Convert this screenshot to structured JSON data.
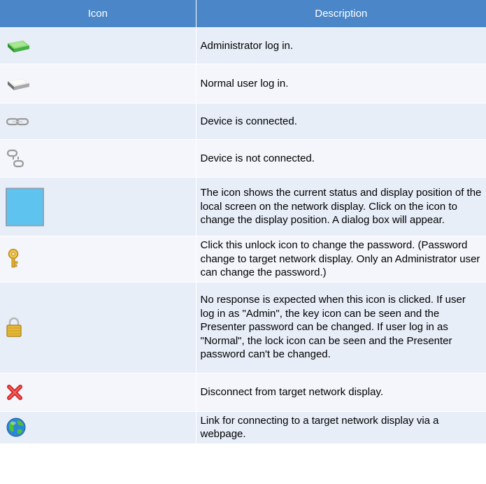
{
  "table": {
    "headers": {
      "icon": "Icon",
      "description": "Description"
    },
    "rows": [
      {
        "icon": "admin-login-drive-green-icon",
        "description": "Administrator log in."
      },
      {
        "icon": "normal-user-login-drive-gray-icon",
        "description": "Normal user log in."
      },
      {
        "icon": "chain-link-connected-icon",
        "description": "Device is connected."
      },
      {
        "icon": "broken-chain-link-icon",
        "description": "Device is not connected."
      },
      {
        "icon": "display-position-square-icon",
        "description": "The icon shows the current status and display position of the local screen on the network display. Click on the icon to change the display position. A dialog box will appear."
      },
      {
        "icon": "key-icon",
        "description": "Click this unlock icon to change the password. (Password change to target network display. Only an Administrator user can change the password.)"
      },
      {
        "icon": "padlock-icon",
        "description": "No response is expected when this icon is clicked. If user log in as \"Admin\", the key icon can be seen and the Presenter password  can be changed. If user log in as \"Normal\", the lock icon can be seen and the Presenter password can't be changed."
      },
      {
        "icon": "red-x-disconnect-icon",
        "description": "Disconnect from target network display."
      },
      {
        "icon": "globe-icon",
        "description": "Link for connecting to a target network display via a webpage."
      }
    ]
  },
  "colors": {
    "header_bg": "#4a86c8",
    "header_text": "#ffffff",
    "row_odd_bg": "#e7eef8",
    "row_even_bg": "#f4f6fb",
    "screen_square_fill": "#5ec3ee"
  }
}
